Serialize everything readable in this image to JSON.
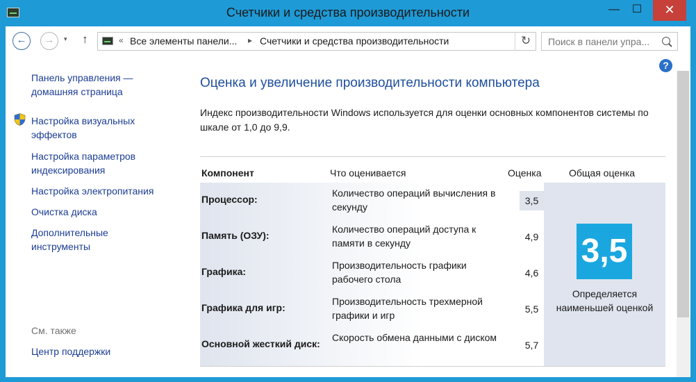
{
  "window": {
    "title": "Счетчики и средства производительности",
    "minimize": "—",
    "maximize": "☐",
    "close": "✕"
  },
  "nav": {
    "back": "←",
    "forward": "→",
    "dropdown": "▾",
    "up": "↑",
    "address": {
      "chevron_left": "«",
      "crumb1": "Все элементы панели...",
      "sep": "▸",
      "crumb2": "Счетчики и средства производительности"
    },
    "refresh": "↻",
    "search_placeholder": "Поиск в панели упра..."
  },
  "help": "?",
  "sidebar": {
    "items": [
      {
        "label": "Панель управления — домашняя страница"
      },
      {
        "label": "Настройка визуальных эффектов"
      },
      {
        "label": "Настройка параметров индексирования"
      },
      {
        "label": "Настройка электропитания"
      },
      {
        "label": "Очистка диска"
      },
      {
        "label": "Дополнительные инструменты"
      }
    ],
    "see_also": "См. также",
    "support_center": "Центр поддержки"
  },
  "main": {
    "title": "Оценка и увеличение производительности компьютера",
    "intro": "Индекс производительности Windows используется для оценки основных компонентов системы по шкале от 1,0 до 9,9.",
    "headers": {
      "component": "Компонент",
      "what": "Что оценивается",
      "score": "Оценка",
      "total": "Общая оценка"
    },
    "rows": [
      {
        "name": "Процессор:",
        "desc": "Количество операций вычисления в секунду",
        "score": "3,5"
      },
      {
        "name": "Память (ОЗУ):",
        "desc": "Количество операций доступа к памяти в секунду",
        "score": "4,9"
      },
      {
        "name": "Графика:",
        "desc": "Производительность графики рабочего стола",
        "score": "4,6"
      },
      {
        "name": "Графика для игр:",
        "desc": "Производительность трехмерной графики и игр",
        "score": "5,5"
      },
      {
        "name": "Основной жесткий диск:",
        "desc": "Скорость обмена данными с диском",
        "score": "5,7"
      }
    ],
    "total_score": "3,5",
    "total_note": "Определяется наименьшей оценкой"
  },
  "colors": {
    "accent": "#1e9ad6",
    "link": "#1c3d94",
    "title": "#1e4e9c",
    "badge": "#1aa7e0"
  }
}
